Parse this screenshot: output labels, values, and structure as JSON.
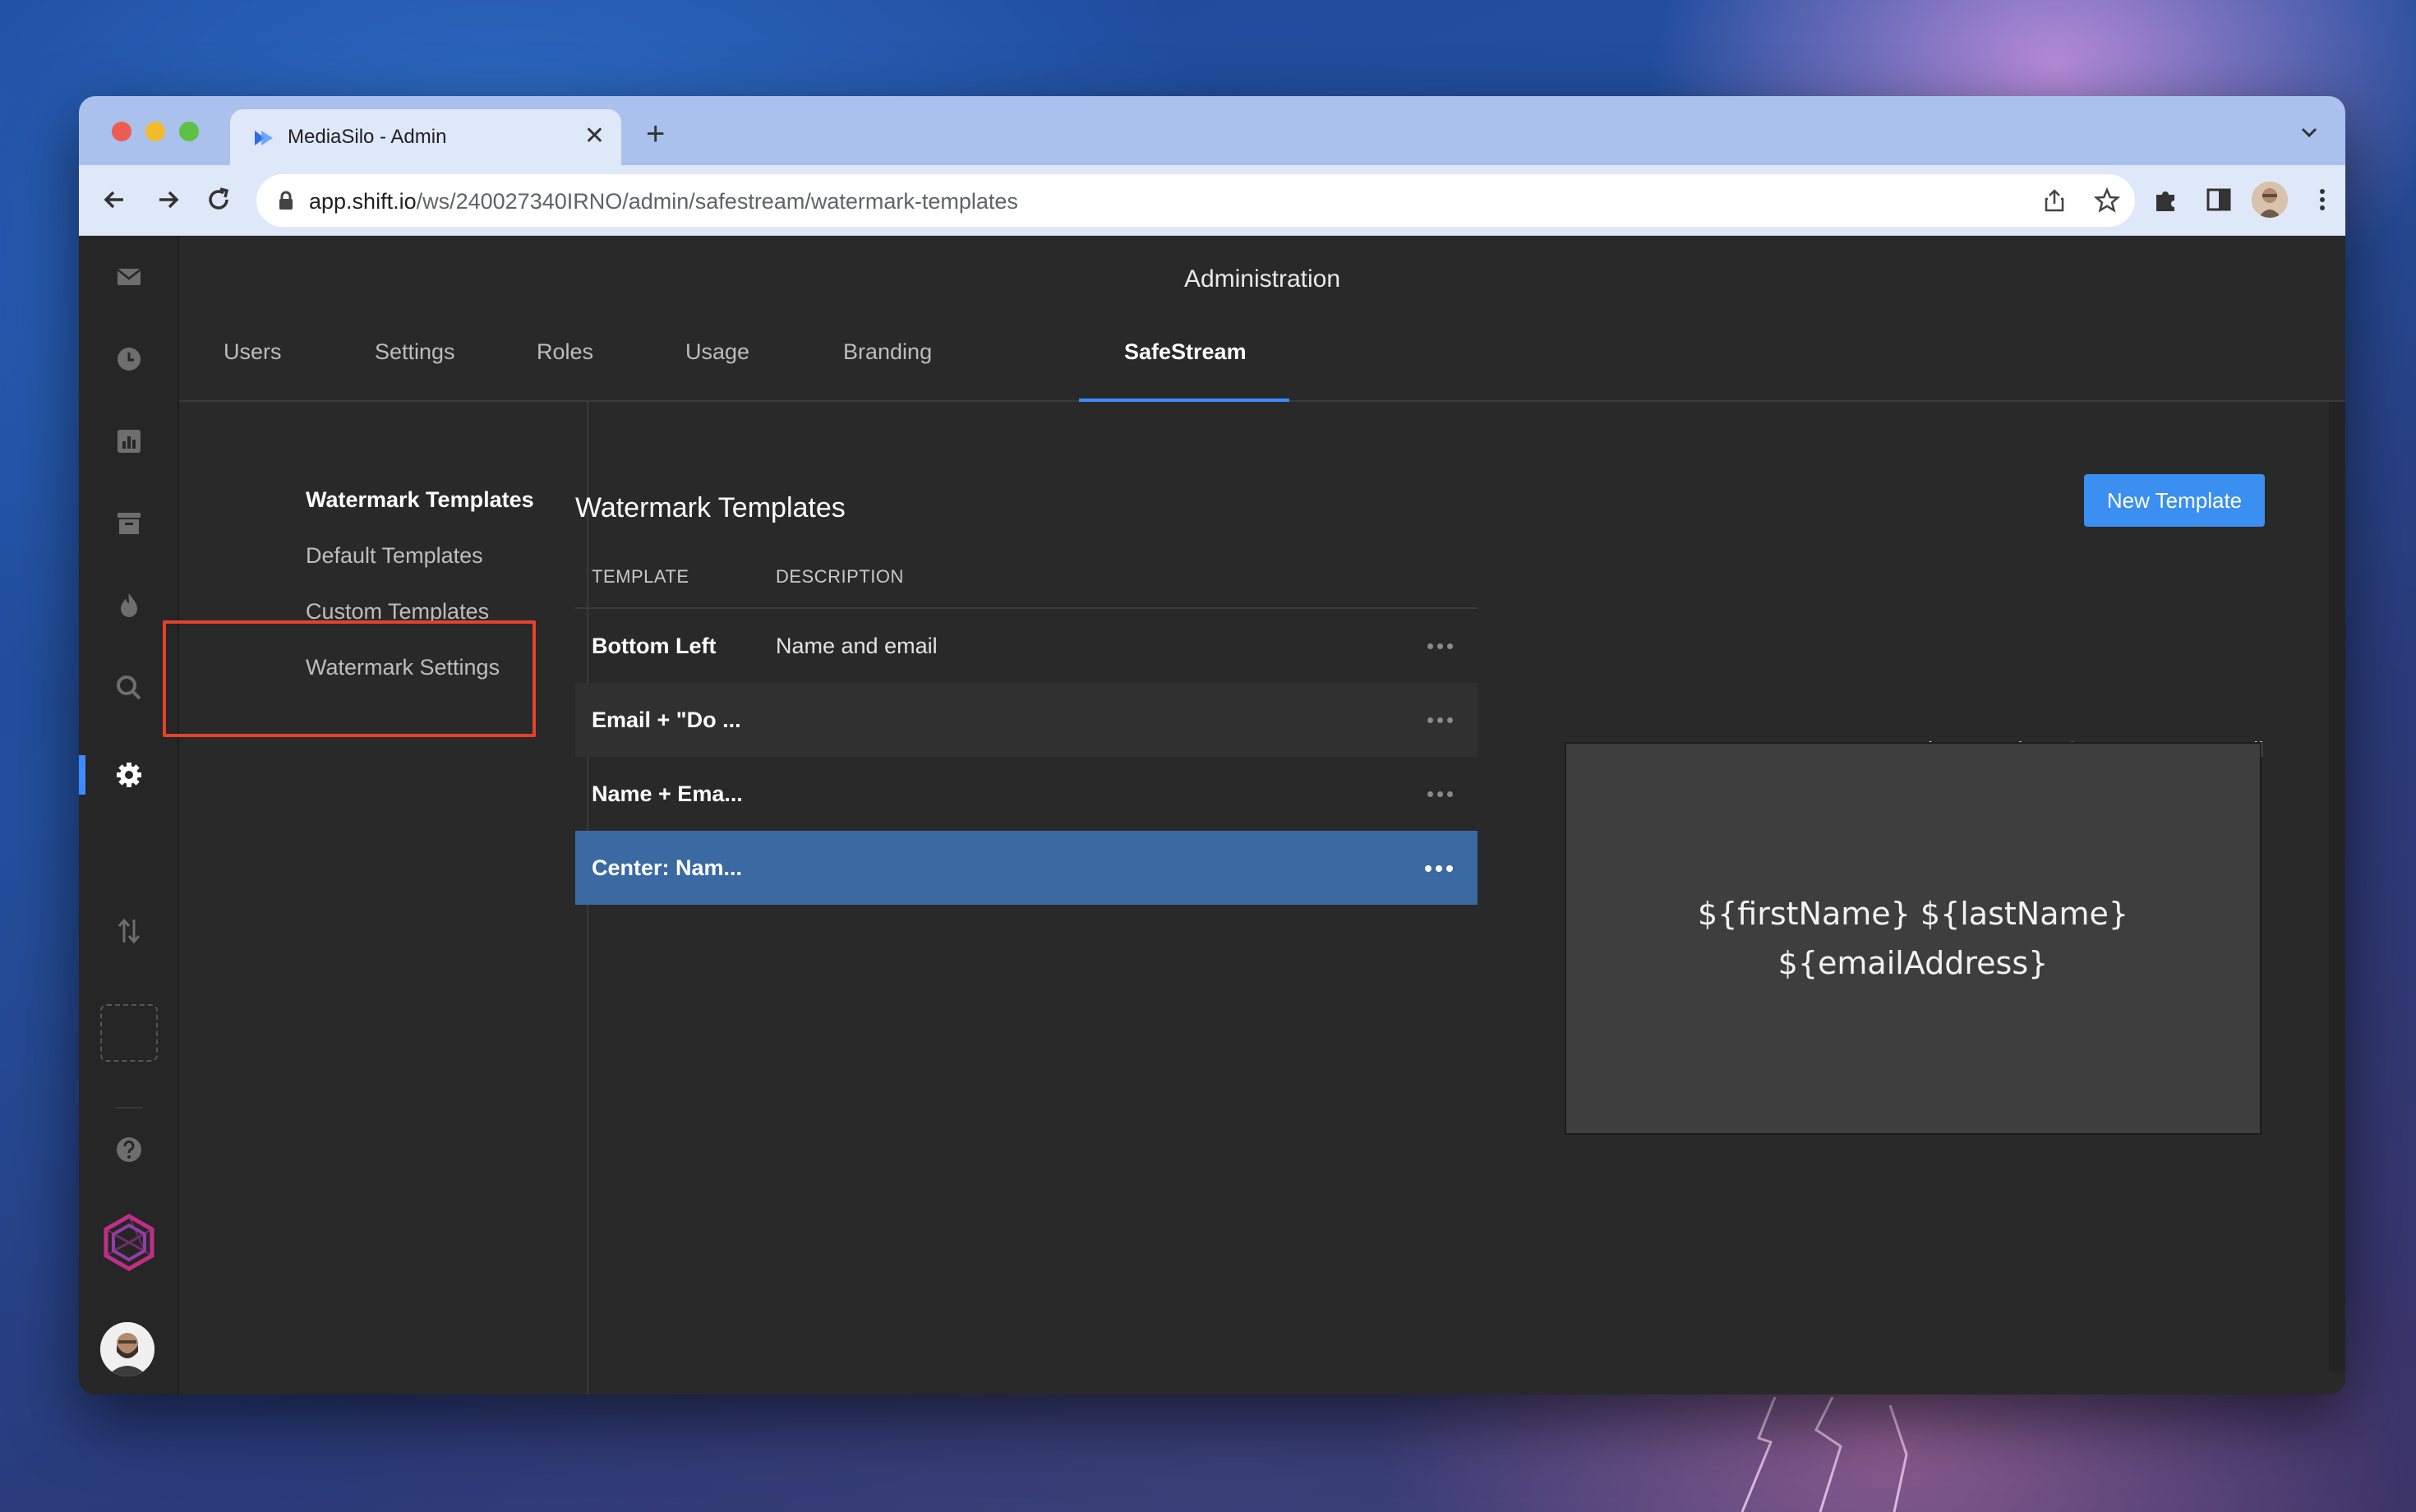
{
  "browser": {
    "tab_title": "MediaSilo - Admin",
    "url_host": "app.shift.io",
    "url_path": "/ws/240027340IRNO/admin/safestream/watermark-templates"
  },
  "app": {
    "header_title": "Administration",
    "tabs": [
      {
        "label": "Users"
      },
      {
        "label": "Settings"
      },
      {
        "label": "Roles"
      },
      {
        "label": "Usage"
      },
      {
        "label": "Branding"
      },
      {
        "label": "SafeStream",
        "active": true
      }
    ],
    "subnav": [
      {
        "label": "Watermark Templates",
        "active": true
      },
      {
        "label": "Default Templates"
      },
      {
        "label": "Custom Templates"
      },
      {
        "label": "Watermark Settings"
      }
    ]
  },
  "content": {
    "title": "Watermark Templates",
    "new_button": "New Template",
    "columns": [
      "TEMPLATE",
      "DESCRIPTION"
    ],
    "rows": [
      {
        "name": "Bottom Left",
        "description": "Name and email"
      },
      {
        "name": "Email + \"Do ...",
        "description": ""
      },
      {
        "name": "Name + Ema...",
        "description": ""
      },
      {
        "name": "Center: Nam...",
        "description": "",
        "selected": true
      }
    ],
    "preview_label": "Preview Template: Center: Name+Email",
    "preview_lines": [
      "${firstName} ${lastName}",
      "${emailAddress}"
    ]
  },
  "colors": {
    "accent": "#3d8bff",
    "button": "#3a8ff0",
    "selected_row": "#3a6aa1",
    "highlight": "#e2432d"
  }
}
